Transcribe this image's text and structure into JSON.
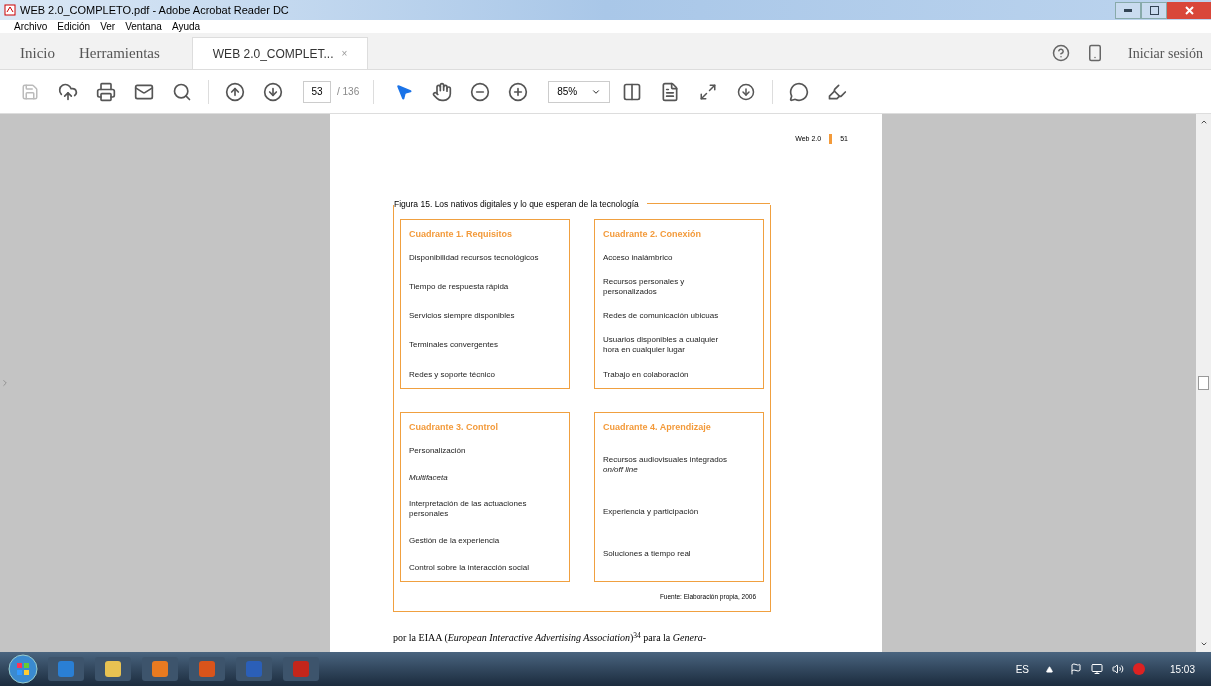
{
  "window": {
    "title": "WEB 2.0_COMPLETO.pdf - Adobe Acrobat Reader DC"
  },
  "menu": [
    "Archivo",
    "Edición",
    "Ver",
    "Ventana",
    "Ayuda"
  ],
  "tabs": [
    {
      "label": "Inicio",
      "selected": false
    },
    {
      "label": "Herramientas",
      "selected": false
    },
    {
      "label": "WEB 2.0_COMPLET...",
      "selected": true,
      "close": "×"
    }
  ],
  "sign_in": "Iniciar sesión",
  "toolbar": {
    "page": "53",
    "total": "/ 136",
    "zoom": "85%"
  },
  "document": {
    "running_head": "Web 2.0",
    "page_number": "51",
    "figure": {
      "caption": "Figura 15. Los nativos digitales y lo que esperan de la tecnología",
      "quadrants": [
        {
          "title": "Cuadrante 1. Requisitos",
          "items": [
            {
              "text": "Disponibilidad recursos tecnológicos",
              "italic": false
            },
            {
              "text": "Tiempo de respuesta rápida",
              "italic": false
            },
            {
              "text": "Servicios siempre disponibles",
              "italic": false
            },
            {
              "text": "Terminales convergentes",
              "italic": false
            },
            {
              "text": "Redes y soporte técnico",
              "italic": false
            }
          ]
        },
        {
          "title": "Cuadrante 2. Conexión",
          "items": [
            {
              "text": "Acceso inalámbrico",
              "italic": false
            },
            {
              "text": "Recursos personales y personalizados",
              "italic": false
            },
            {
              "text": "Redes de comunicación ubicuas",
              "italic": false
            },
            {
              "text": "Usuarios disponibles a cualquier hora en cualquier lugar",
              "italic": false
            },
            {
              "text": "Trabajo en colaboración",
              "italic": false
            }
          ]
        },
        {
          "title": "Cuadrante 3. Control",
          "items": [
            {
              "text": "Personalización",
              "italic": false
            },
            {
              "text": "Multifaceta",
              "italic": true
            },
            {
              "text": "Interpretación de las actuaciones personales",
              "italic": false
            },
            {
              "text": "Gestión de la experiencia",
              "italic": false
            },
            {
              "text": "Control sobre la interacción social",
              "italic": false
            }
          ]
        },
        {
          "title": "Cuadrante 4. Aprendizaje",
          "items": [
            {
              "text": "Recursos audiovisuales integrados *on/off line*",
              "italic": false
            },
            {
              "text": "Experiencia y participación",
              "italic": false
            },
            {
              "text": "Soluciones a tiempo real",
              "italic": false
            }
          ]
        }
      ],
      "source": "Fuente: Elaboración propia, 2006"
    },
    "paragraph": "por la EIAA (*European Interactive Advertising Association*)$^{34}$ para la *Genera-*"
  },
  "taskbar": {
    "language": "ES",
    "time": "15:03"
  }
}
